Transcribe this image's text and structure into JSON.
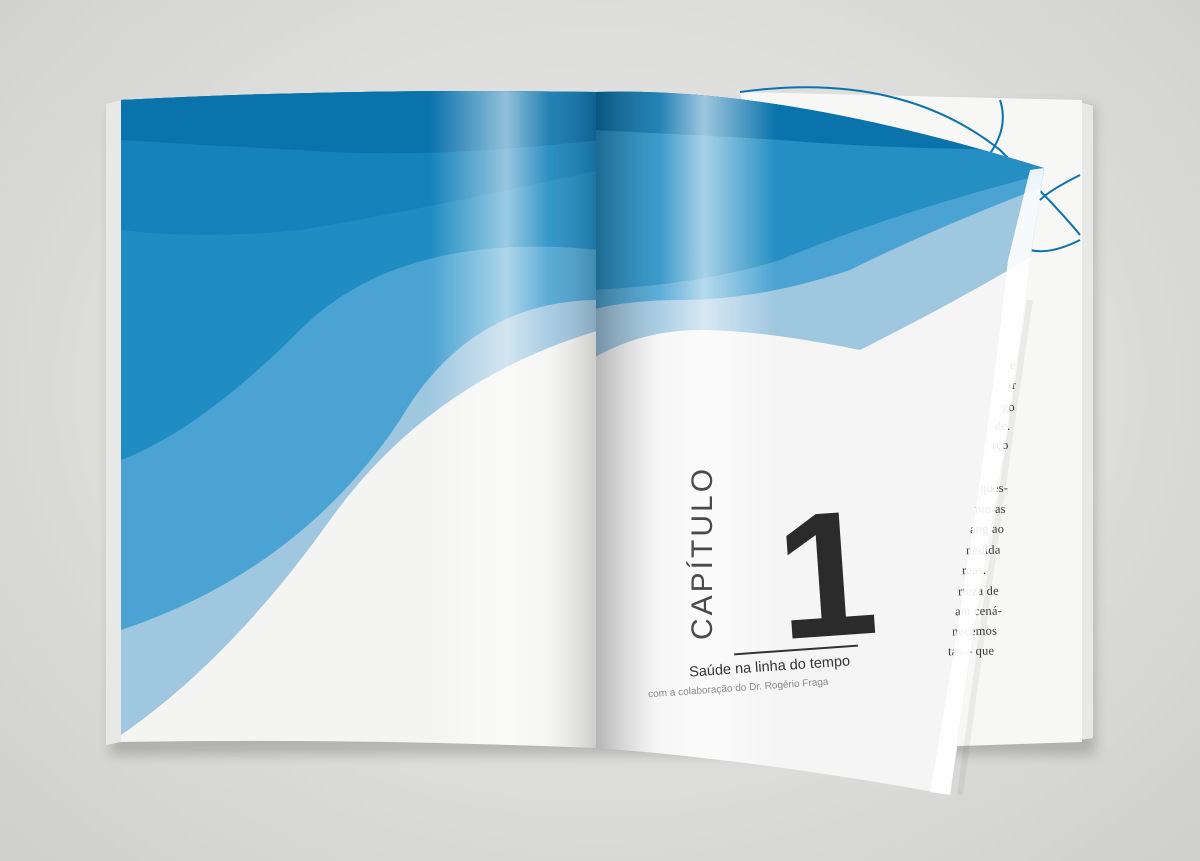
{
  "chapter": {
    "label": "CAPÍTULO",
    "number": "1",
    "title": "Saúde na linha do tempo",
    "subtitle": "com a colaboração do Dr. Rogério Fraga"
  },
  "underlying_page_lines": [
    "e",
    "ir",
    "go",
    "de.",
    "rço",
    "ques-",
    "nto as",
    "ang ao",
    "nedida",
    "reas.",
    "rteza de",
    "am cená-",
    "necemos",
    "tas – que"
  ],
  "colors": {
    "background": "#dcdcda",
    "blue_dark": "#0b73ac",
    "blue_mid": "#1f8cc2",
    "blue_light": "#9fc7e0",
    "paper": "#f5f5f5",
    "text_dark": "#2b2b2b"
  }
}
